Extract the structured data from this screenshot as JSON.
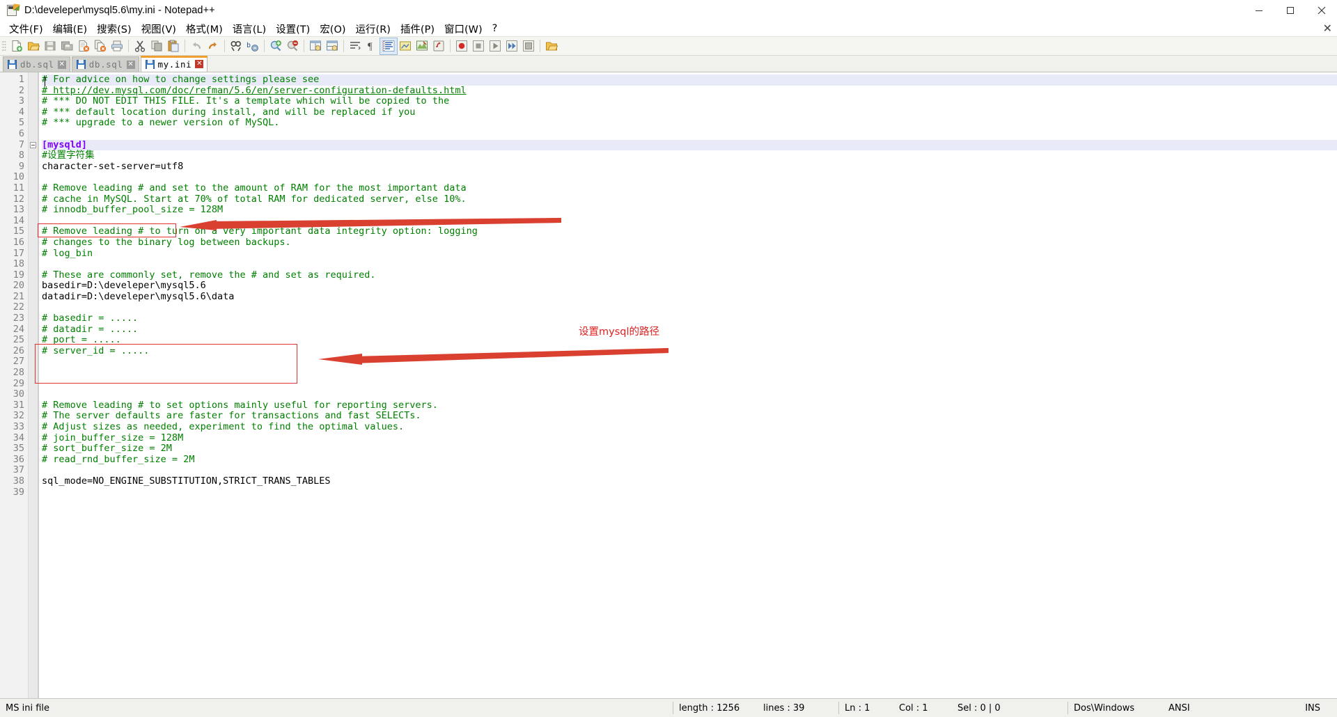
{
  "window": {
    "title": "D:\\develeper\\mysql5.6\\my.ini - Notepad++",
    "icon": "notepad-plus-plus-icon",
    "minimize": "─",
    "maximize": "☐",
    "close": "✕"
  },
  "menu": {
    "items": [
      {
        "label": "文件(F)",
        "name": "menu-file"
      },
      {
        "label": "编辑(E)",
        "name": "menu-edit"
      },
      {
        "label": "搜索(S)",
        "name": "menu-search"
      },
      {
        "label": "视图(V)",
        "name": "menu-view"
      },
      {
        "label": "格式(M)",
        "name": "menu-format"
      },
      {
        "label": "语言(L)",
        "name": "menu-language"
      },
      {
        "label": "设置(T)",
        "name": "menu-settings"
      },
      {
        "label": "宏(O)",
        "name": "menu-macro"
      },
      {
        "label": "运行(R)",
        "name": "menu-run"
      },
      {
        "label": "插件(P)",
        "name": "menu-plugins"
      },
      {
        "label": "窗口(W)",
        "name": "menu-window"
      },
      {
        "label": "?",
        "name": "menu-help"
      }
    ],
    "close_doc": "✕"
  },
  "toolbar": {
    "buttons": [
      "new-file-icon",
      "open-file-icon",
      "save-icon",
      "save-all-icon",
      "close-file-icon",
      "close-all-icon",
      "print-icon",
      "sep",
      "cut-icon",
      "copy-icon",
      "paste-icon",
      "sep",
      "undo-icon",
      "redo-icon",
      "sep",
      "find-icon",
      "replace-icon",
      "sep",
      "zoom-in-icon",
      "zoom-out-icon",
      "sep",
      "sync-vertical-icon",
      "sync-horizontal-icon",
      "sep",
      "word-wrap-icon",
      "show-all-chars-icon",
      "indent-guide-icon",
      "user-defined-dialog-icon",
      "document-map-icon",
      "function-list-icon",
      "sep",
      "record-macro-icon",
      "stop-macro-icon",
      "play-macro-icon",
      "fast-play-macro-icon",
      "save-macro-icon",
      "sep",
      "folder-as-workspace-icon"
    ]
  },
  "tabs": [
    {
      "label": "db.sql",
      "active": false,
      "name": "tab-db-sql-1"
    },
    {
      "label": "db.sql",
      "active": false,
      "name": "tab-db-sql-2"
    },
    {
      "label": "my.ini",
      "active": true,
      "name": "tab-my-ini"
    }
  ],
  "editor": {
    "total_lines": 39,
    "current_line": 1,
    "lines": [
      {
        "n": 1,
        "text": "# For advice on how to change settings please see",
        "style": "comment",
        "current": true
      },
      {
        "n": 2,
        "text": "# http://dev.mysql.com/doc/refman/5.6/en/server-configuration-defaults.html",
        "style": "comment-link"
      },
      {
        "n": 3,
        "text": "# *** DO NOT EDIT THIS FILE. It's a template which will be copied to the",
        "style": "comment"
      },
      {
        "n": 4,
        "text": "# *** default location during install, and will be replaced if you",
        "style": "comment"
      },
      {
        "n": 5,
        "text": "# *** upgrade to a newer version of MySQL.",
        "style": "comment"
      },
      {
        "n": 6,
        "text": "",
        "style": "plain"
      },
      {
        "n": 7,
        "text": "[mysqld]",
        "style": "section",
        "fold": true,
        "current": true
      },
      {
        "n": 8,
        "text": "#设置字符集",
        "style": "comment"
      },
      {
        "n": 9,
        "text": "character-set-server=utf8",
        "style": "plain"
      },
      {
        "n": 10,
        "text": "",
        "style": "plain"
      },
      {
        "n": 11,
        "text": "# Remove leading # and set to the amount of RAM for the most important data",
        "style": "comment"
      },
      {
        "n": 12,
        "text": "# cache in MySQL. Start at 70% of total RAM for dedicated server, else 10%.",
        "style": "comment"
      },
      {
        "n": 13,
        "text": "# innodb_buffer_pool_size = 128M",
        "style": "comment"
      },
      {
        "n": 14,
        "text": "",
        "style": "plain"
      },
      {
        "n": 15,
        "text": "# Remove leading # to turn on a very important data integrity option: logging",
        "style": "comment"
      },
      {
        "n": 16,
        "text": "# changes to the binary log between backups.",
        "style": "comment"
      },
      {
        "n": 17,
        "text": "# log_bin",
        "style": "comment"
      },
      {
        "n": 18,
        "text": "",
        "style": "plain"
      },
      {
        "n": 19,
        "text": "# These are commonly set, remove the # and set as required.",
        "style": "comment"
      },
      {
        "n": 20,
        "text": "basedir=D:\\develeper\\mysql5.6",
        "style": "plain"
      },
      {
        "n": 21,
        "text": "datadir=D:\\develeper\\mysql5.6\\data",
        "style": "plain"
      },
      {
        "n": 22,
        "text": "",
        "style": "plain"
      },
      {
        "n": 23,
        "text": "# basedir = .....",
        "style": "comment"
      },
      {
        "n": 24,
        "text": "# datadir = .....",
        "style": "comment"
      },
      {
        "n": 25,
        "text": "# port = .....",
        "style": "comment"
      },
      {
        "n": 26,
        "text": "# server_id = .....",
        "style": "comment"
      },
      {
        "n": 27,
        "text": "",
        "style": "plain"
      },
      {
        "n": 28,
        "text": "",
        "style": "plain"
      },
      {
        "n": 29,
        "text": "",
        "style": "plain"
      },
      {
        "n": 30,
        "text": "",
        "style": "plain"
      },
      {
        "n": 31,
        "text": "# Remove leading # to set options mainly useful for reporting servers.",
        "style": "comment"
      },
      {
        "n": 32,
        "text": "# The server defaults are faster for transactions and fast SELECTs.",
        "style": "comment"
      },
      {
        "n": 33,
        "text": "# Adjust sizes as needed, experiment to find the optimal values.",
        "style": "comment"
      },
      {
        "n": 34,
        "text": "# join_buffer_size = 128M",
        "style": "comment"
      },
      {
        "n": 35,
        "text": "# sort_buffer_size = 2M",
        "style": "comment"
      },
      {
        "n": 36,
        "text": "# read_rnd_buffer_size = 2M",
        "style": "comment"
      },
      {
        "n": 37,
        "text": "",
        "style": "plain"
      },
      {
        "n": 38,
        "text": "sql_mode=NO_ENGINE_SUBSTITUTION,STRICT_TRANS_TABLES",
        "style": "plain"
      },
      {
        "n": 39,
        "text": "",
        "style": "plain"
      }
    ]
  },
  "annotations": {
    "color": "#e02020",
    "label_path": "设置mysql的路径",
    "box1_name": "charset-highlight-box",
    "box2_name": "path-highlight-box",
    "arrow1_name": "charset-arrow",
    "arrow2_name": "path-arrow"
  },
  "statusbar": {
    "file_type": "MS ini file",
    "length_label": "length : 1256",
    "lines_label": "lines : 39",
    "ln": "Ln : 1",
    "col": "Col : 1",
    "sel": "Sel : 0 | 0",
    "eol": "Dos\\Windows",
    "encoding": "ANSI",
    "insert_mode": "INS"
  }
}
